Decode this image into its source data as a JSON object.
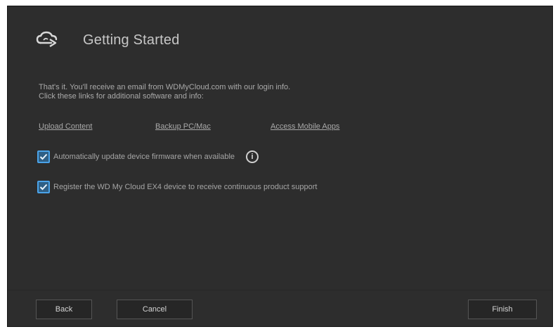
{
  "dialog": {
    "title": "Getting Started",
    "message_line1": "That's it. You'll receive an email from WDMyCloud.com with our login info.",
    "message_line2": "Click these links for additional software and info:"
  },
  "links": [
    {
      "label": "Upload Content"
    },
    {
      "label": "Backup PC/Mac"
    },
    {
      "label": "Access Mobile Apps"
    }
  ],
  "options": {
    "auto_update": {
      "label": "Automatically update device firmware when available",
      "checked": true
    },
    "register": {
      "label": "Register the WD My Cloud EX4 device to receive continuous product support",
      "checked": true
    }
  },
  "buttons": {
    "back": "Back",
    "cancel": "Cancel",
    "finish": "Finish"
  },
  "colors": {
    "background": "#2d2d2d",
    "checkbox_accent": "#4aa3e8"
  },
  "icons": {
    "header": "cloud-sync-icon",
    "info": "info-icon",
    "check": "checkmark-icon"
  }
}
